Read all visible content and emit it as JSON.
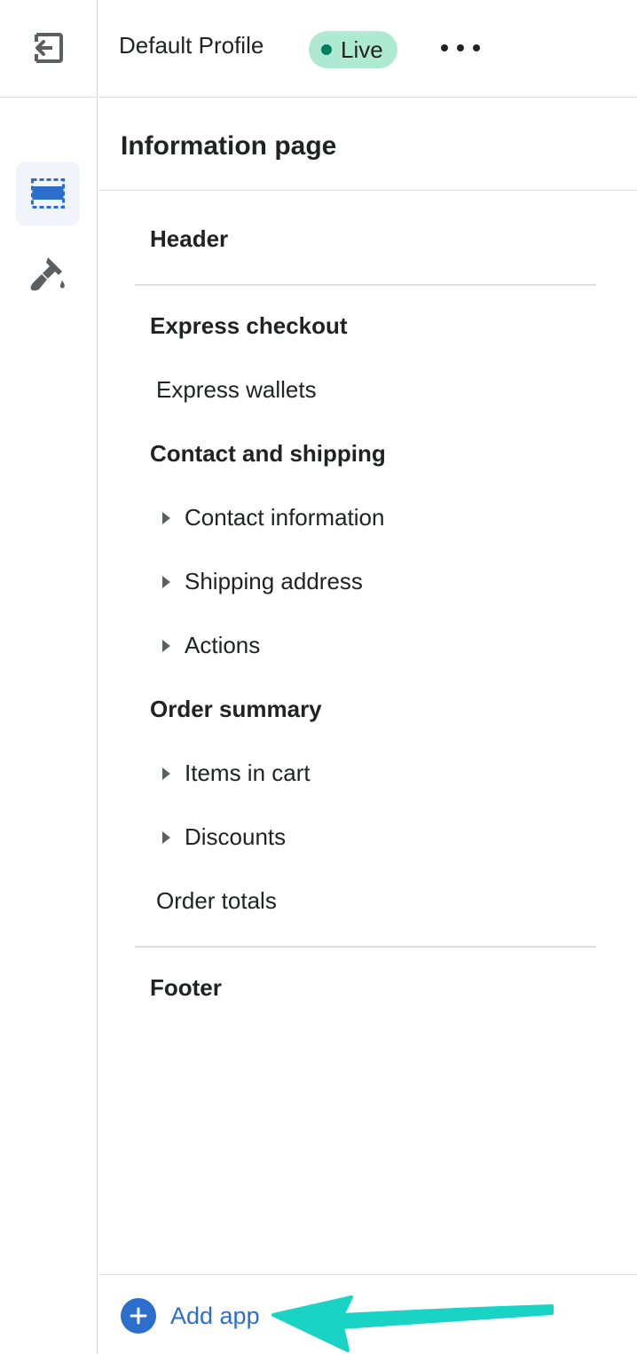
{
  "header": {
    "profile_name": "Default Profile",
    "status_badge": "Live",
    "colors": {
      "badge_bg": "#aee9d1",
      "badge_dot": "#007f5f",
      "accent": "#2c6ecb"
    }
  },
  "rail": {
    "items": [
      {
        "icon": "exit-icon"
      },
      {
        "icon": "sections-icon",
        "active": true
      },
      {
        "icon": "paintbrush-icon"
      }
    ]
  },
  "panel": {
    "title": "Information page",
    "groups": [
      {
        "label": "Header",
        "children": []
      },
      {
        "label": "Express checkout",
        "children": [
          {
            "label": "Express wallets",
            "expandable": false
          }
        ]
      },
      {
        "label": "Contact and shipping",
        "children": [
          {
            "label": "Contact information",
            "expandable": true
          },
          {
            "label": "Shipping address",
            "expandable": true
          },
          {
            "label": "Actions",
            "expandable": true
          }
        ]
      },
      {
        "label": "Order summary",
        "children": [
          {
            "label": "Items in cart",
            "expandable": true
          },
          {
            "label": "Discounts",
            "expandable": true
          },
          {
            "label": "Order totals",
            "expandable": false
          }
        ]
      },
      {
        "label": "Footer",
        "children": []
      }
    ]
  },
  "footer": {
    "add_app_label": "Add app",
    "annotation_arrow_color": "#19d3c5"
  }
}
